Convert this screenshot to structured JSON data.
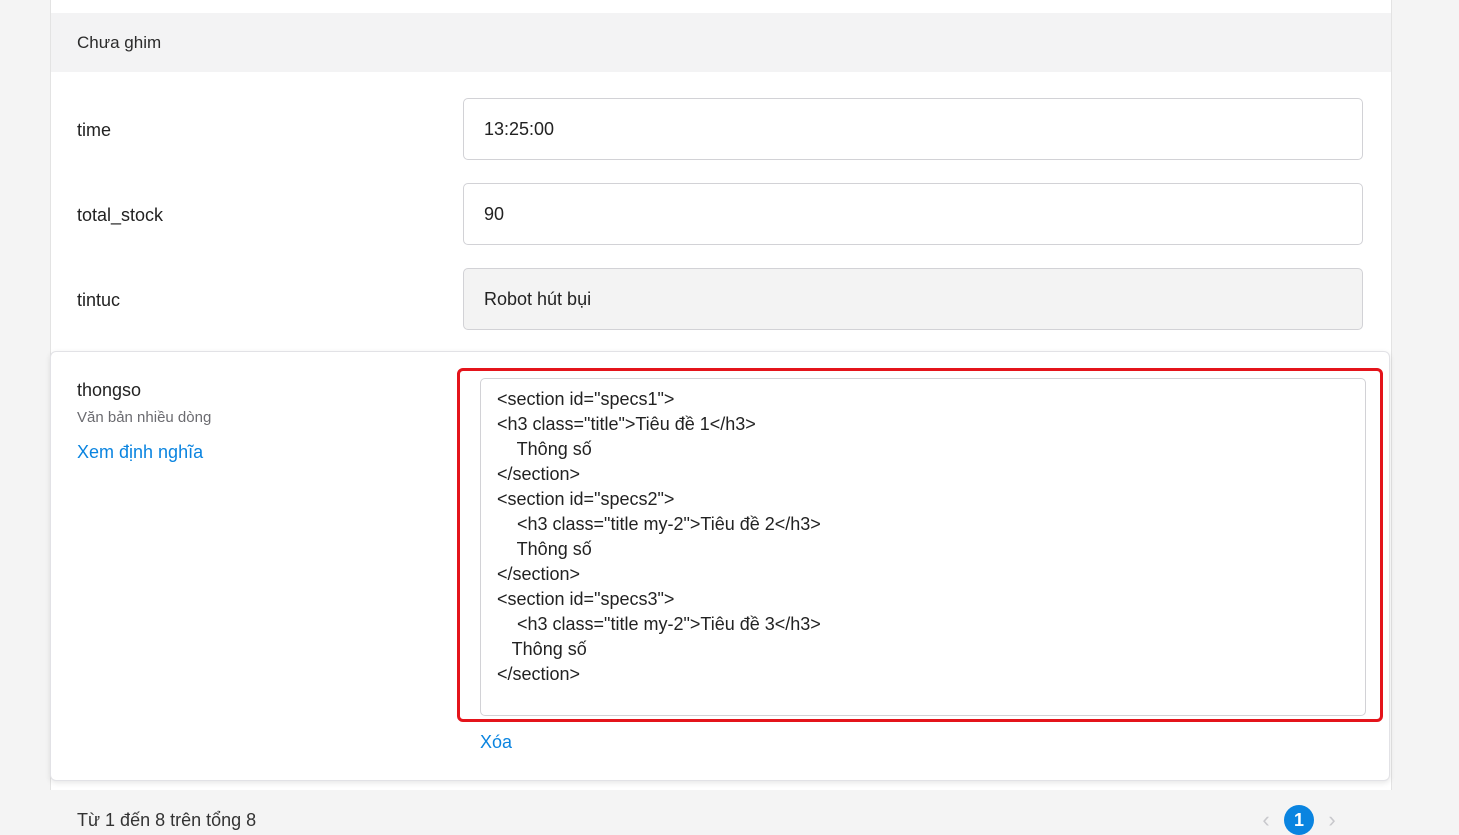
{
  "section": {
    "title": "Chưa ghim"
  },
  "fields": [
    {
      "label": "time",
      "value": "13:25:00",
      "readonly": false
    },
    {
      "label": "total_stock",
      "value": "90",
      "readonly": false
    },
    {
      "label": "tintuc",
      "value": "Robot hút bụi",
      "readonly": true
    }
  ],
  "thongso": {
    "label": "thongso",
    "type_label": "Văn bản nhiều dòng",
    "definition_link": "Xem định nghĩa",
    "content": "<section id=\"specs1\">\n<h3 class=\"title\">Tiêu đề 1</h3>\n    Thông số\n</section>\n<section id=\"specs2\">\n    <h3 class=\"title my-2\">Tiêu đề 2</h3>\n    Thông số\n</section>\n<section id=\"specs3\">\n    <h3 class=\"title my-2\">Tiêu đề 3</h3>\n   Thông số\n</section>",
    "delete_link": "Xóa"
  },
  "pagination": {
    "summary": "Từ 1 đến 8 trên tổng 8",
    "current_page": "1",
    "prev_icon": "chevron-left-icon",
    "next_icon": "chevron-right-icon"
  },
  "colors": {
    "accent": "#0a84e0",
    "highlight": "#e4141b"
  }
}
